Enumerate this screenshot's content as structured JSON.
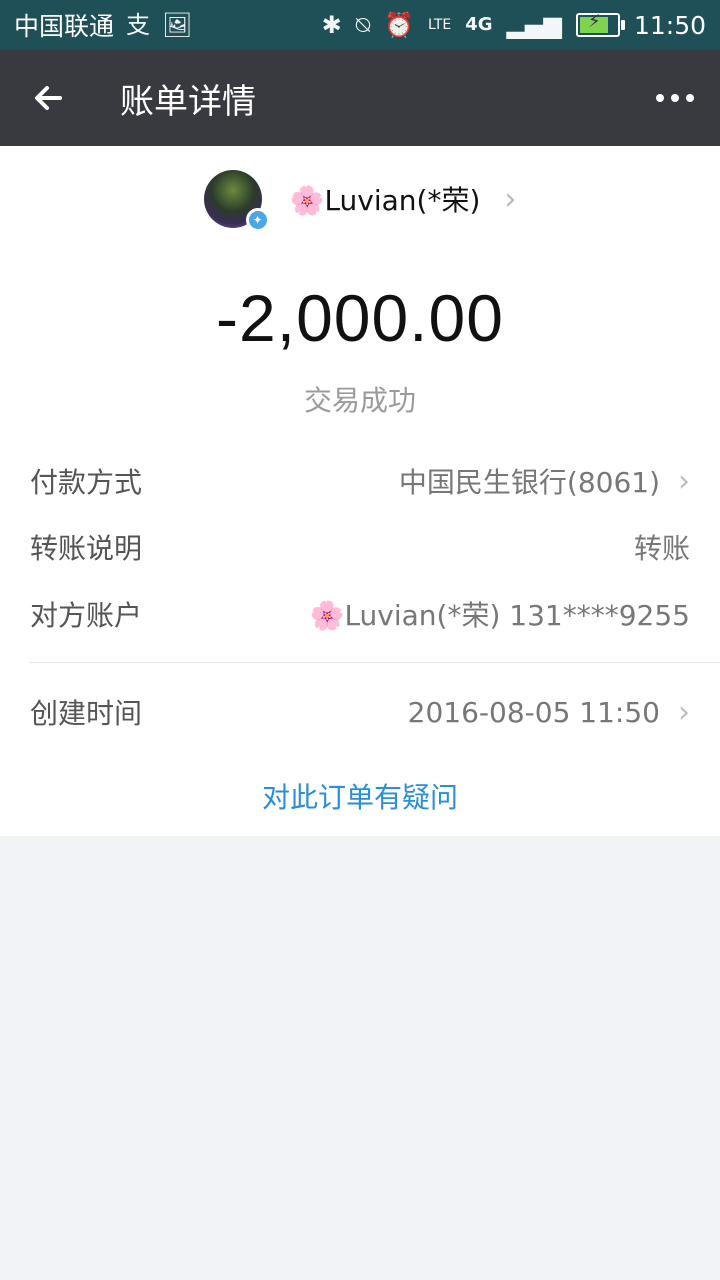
{
  "status_bar": {
    "carrier": "中国联通",
    "time": "11:50",
    "network": "4G",
    "lte_label": "LTE",
    "icons": [
      "alipay-icon",
      "gallery-icon",
      "bluetooth-icon",
      "vibrate-icon",
      "alarm-icon",
      "signal-icon",
      "battery-charging-icon"
    ]
  },
  "navbar": {
    "title": "账单详情",
    "back_icon": "arrow-left-icon",
    "more_icon": "more-dots-icon"
  },
  "payee": {
    "name": "🌸Luvian(*荣)",
    "avatar_icon": "avatar-image",
    "verified_icon": "verified-badge-icon"
  },
  "amount": "-2,000.00",
  "status": "交易成功",
  "details": [
    {
      "label": "付款方式",
      "value": "中国民生银行(8061)"
    },
    {
      "label": "转账说明",
      "value": "转账"
    },
    {
      "label": "对方账户",
      "value": "🌸Luvian(*荣) 131****9255"
    },
    {
      "label": "创建时间",
      "value": "2016-08-05 11:50"
    }
  ],
  "question_link": "对此订单有疑问",
  "colors": {
    "status_bar": "#1f4f57",
    "navbar": "#393a3f",
    "link": "#2a8ed8",
    "background": "#f2f3f7"
  }
}
